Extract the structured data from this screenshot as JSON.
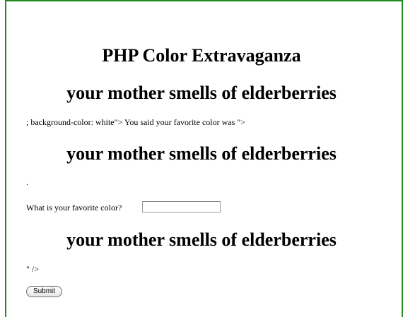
{
  "page": {
    "title": "PHP Color Extravaganza",
    "heading": "your mother smells of elderberries",
    "echo_line": "; background-color: white\"> You said your favorite color was \">",
    "dot_line": ".",
    "prompt_label": "What is your favorite color?",
    "color_value": "",
    "closing_fragment": "\" />",
    "submit_label": "Submit"
  },
  "colors": {
    "frame_border": "#1f8a1f"
  }
}
